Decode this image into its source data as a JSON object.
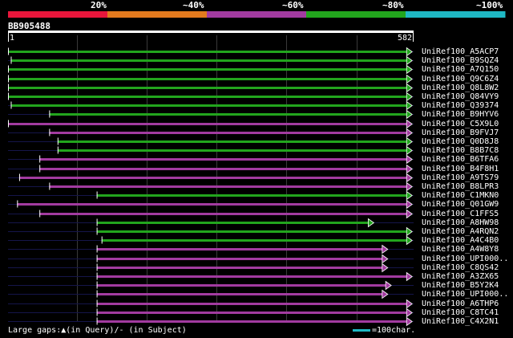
{
  "query": {
    "id": "BB905488",
    "length": 582,
    "start_label": "1",
    "end_label": "582"
  },
  "identity_legend": {
    "labels": [
      "20%",
      "~40%",
      "~60%",
      "~80%",
      "~100%"
    ],
    "colors": [
      "#e8163b",
      "#e37a1e",
      "#a23ba0",
      "#22a51d",
      "#1fb8c4"
    ]
  },
  "hits": [
    {
      "name": "UniRef100_A5ACP7",
      "color": "green",
      "start": 1,
      "end": 580
    },
    {
      "name": "UniRef100_B9SQZ4",
      "color": "green",
      "start": 5,
      "end": 580
    },
    {
      "name": "UniRef100_A7Q150",
      "color": "green",
      "start": 1,
      "end": 580
    },
    {
      "name": "UniRef100_Q9C6Z4",
      "color": "green",
      "start": 1,
      "end": 580
    },
    {
      "name": "UniRef100_Q8L8W2",
      "color": "green",
      "start": 1,
      "end": 580
    },
    {
      "name": "UniRef100_Q84VY9",
      "color": "green",
      "start": 1,
      "end": 580
    },
    {
      "name": "UniRef100_Q39374",
      "color": "green",
      "start": 5,
      "end": 580
    },
    {
      "name": "UniRef100_B9HYV6",
      "color": "green",
      "start": 60,
      "end": 580
    },
    {
      "name": "UniRef100_C5X9L0",
      "color": "purple",
      "start": 1,
      "end": 580
    },
    {
      "name": "UniRef100_B9FVJ7",
      "color": "purple",
      "start": 60,
      "end": 580
    },
    {
      "name": "UniRef100_Q0D8J8",
      "color": "green",
      "start": 72,
      "end": 580
    },
    {
      "name": "UniRef100_B8B7C8",
      "color": "green",
      "start": 72,
      "end": 580
    },
    {
      "name": "UniRef100_B6TFA6",
      "color": "purple",
      "start": 46,
      "end": 580
    },
    {
      "name": "UniRef100_B4F8H1",
      "color": "purple",
      "start": 46,
      "end": 580
    },
    {
      "name": "UniRef100_A9TS79",
      "color": "purple",
      "start": 17,
      "end": 580
    },
    {
      "name": "UniRef100_B8LPR3",
      "color": "purple",
      "start": 60,
      "end": 580
    },
    {
      "name": "UniRef100_C1MKN0",
      "color": "green",
      "start": 128,
      "end": 580
    },
    {
      "name": "UniRef100_Q01GW9",
      "color": "purple",
      "start": 14,
      "end": 580
    },
    {
      "name": "UniRef100_C1FFS5",
      "color": "purple",
      "start": 46,
      "end": 580
    },
    {
      "name": "UniRef100_A8HW98",
      "color": "green",
      "start": 128,
      "end": 525
    },
    {
      "name": "UniRef100_A4RQN2",
      "color": "green",
      "start": 128,
      "end": 580
    },
    {
      "name": "UniRef100_A4C4B0",
      "color": "green",
      "start": 135,
      "end": 580
    },
    {
      "name": "UniRef100_A4W8Y8",
      "color": "purple",
      "start": 128,
      "end": 545
    },
    {
      "name": "UniRef100_UPI000..",
      "color": "purple",
      "start": 128,
      "end": 545
    },
    {
      "name": "UniRef100_C8QS42",
      "color": "purple",
      "start": 128,
      "end": 545
    },
    {
      "name": "UniRef100_A3ZX65",
      "color": "purple",
      "start": 128,
      "end": 580
    },
    {
      "name": "UniRef100_B5Y2K4",
      "color": "purple",
      "start": 128,
      "end": 550
    },
    {
      "name": "UniRef100_UPI000..",
      "color": "purple",
      "start": 128,
      "end": 545
    },
    {
      "name": "UniRef100_A6THP6",
      "color": "purple",
      "start": 128,
      "end": 580
    },
    {
      "name": "UniRef100_C8TC41",
      "color": "purple",
      "start": 128,
      "end": 580
    },
    {
      "name": "UniRef100_C4X2N1",
      "color": "purple",
      "start": 128,
      "end": 580
    }
  ],
  "footer": {
    "gaps_text": "Large gaps:▲(in Query)/- (in Subject)",
    "scale_text": "=100char.",
    "scale_color": "#1fb8c4"
  }
}
